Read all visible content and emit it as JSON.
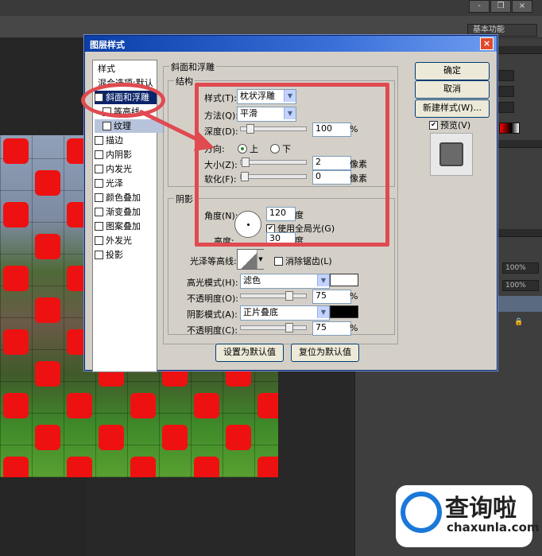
{
  "app": {
    "workspace": "基本功能",
    "zoom_1": "100%",
    "zoom_2": "100%",
    "window_buttons": [
      "-",
      "❐",
      "×"
    ]
  },
  "dialog": {
    "title": "图层样式",
    "close": "×",
    "style_list": [
      {
        "label": "样式",
        "checkbox": false,
        "selected": false,
        "indent": false
      },
      {
        "label": "混合选项:默认",
        "checkbox": false,
        "selected": false,
        "indent": false
      },
      {
        "label": "斜面和浮雕",
        "checkbox": true,
        "checked": true,
        "selected": true,
        "indent": false
      },
      {
        "label": "等高线",
        "checkbox": true,
        "checked": false,
        "selected": false,
        "indent": true
      },
      {
        "label": "纹理",
        "checkbox": true,
        "checked": false,
        "selected": false,
        "indent": true
      },
      {
        "label": "描边",
        "checkbox": true,
        "checked": false,
        "selected": false,
        "indent": false
      },
      {
        "label": "内阴影",
        "checkbox": true,
        "checked": false,
        "selected": false,
        "indent": false
      },
      {
        "label": "内发光",
        "checkbox": true,
        "checked": false,
        "selected": false,
        "indent": false
      },
      {
        "label": "光泽",
        "checkbox": true,
        "checked": false,
        "selected": false,
        "indent": false
      },
      {
        "label": "颜色叠加",
        "checkbox": true,
        "checked": false,
        "selected": false,
        "indent": false
      },
      {
        "label": "渐变叠加",
        "checkbox": true,
        "checked": false,
        "selected": false,
        "indent": false
      },
      {
        "label": "图案叠加",
        "checkbox": true,
        "checked": false,
        "selected": false,
        "indent": false
      },
      {
        "label": "外发光",
        "checkbox": true,
        "checked": false,
        "selected": false,
        "indent": false
      },
      {
        "label": "投影",
        "checkbox": true,
        "checked": false,
        "selected": false,
        "indent": false
      }
    ],
    "bevel": {
      "group_title": "斜面和浮雕",
      "structure_title": "结构",
      "style_label": "样式(T):",
      "style_value": "枕状浮雕",
      "technique_label": "方法(Q):",
      "technique_value": "平滑",
      "depth_label": "深度(D):",
      "depth_value": "100",
      "depth_unit": "%",
      "depth_fraction": 0.1,
      "direction_label": "方向:",
      "direction_up": "上",
      "direction_down": "下",
      "size_label": "大小(Z):",
      "size_value": "2",
      "size_unit": "像素",
      "size_fraction": 0.02,
      "soften_label": "软化(F):",
      "soften_value": "0",
      "soften_unit": "像素",
      "soften_fraction": 0.0
    },
    "shading": {
      "title": "阴影",
      "angle_label": "角度(N):",
      "angle_value": "120",
      "angle_unit": "度",
      "global_light_label": "使用全局光(G)",
      "altitude_label": "高度:",
      "altitude_value": "30",
      "altitude_unit": "度",
      "gloss_label": "光泽等高线:",
      "antialias_label": "消除锯齿(L)",
      "highlight_mode_label": "高光模式(H):",
      "highlight_mode_value": "滤色",
      "highlight_color": "#ffffff",
      "highlight_opacity_label": "不透明度(O):",
      "highlight_opacity_value": "75",
      "highlight_opacity_fraction": 0.75,
      "shadow_mode_label": "阴影模式(A):",
      "shadow_mode_value": "正片叠底",
      "shadow_color": "#000000",
      "shadow_opacity_label": "不透明度(C):",
      "shadow_opacity_value": "75",
      "shadow_opacity_fraction": 0.75,
      "unit_percent": "%"
    },
    "buttons": {
      "ok": "确定",
      "cancel": "取消",
      "new_style": "新建样式(W)...",
      "preview": "预览(V)",
      "make_default": "设置为默认值",
      "reset_default": "复位为默认值"
    }
  },
  "watermark": {
    "name": "查询啦",
    "url": "chaxunla.com"
  }
}
